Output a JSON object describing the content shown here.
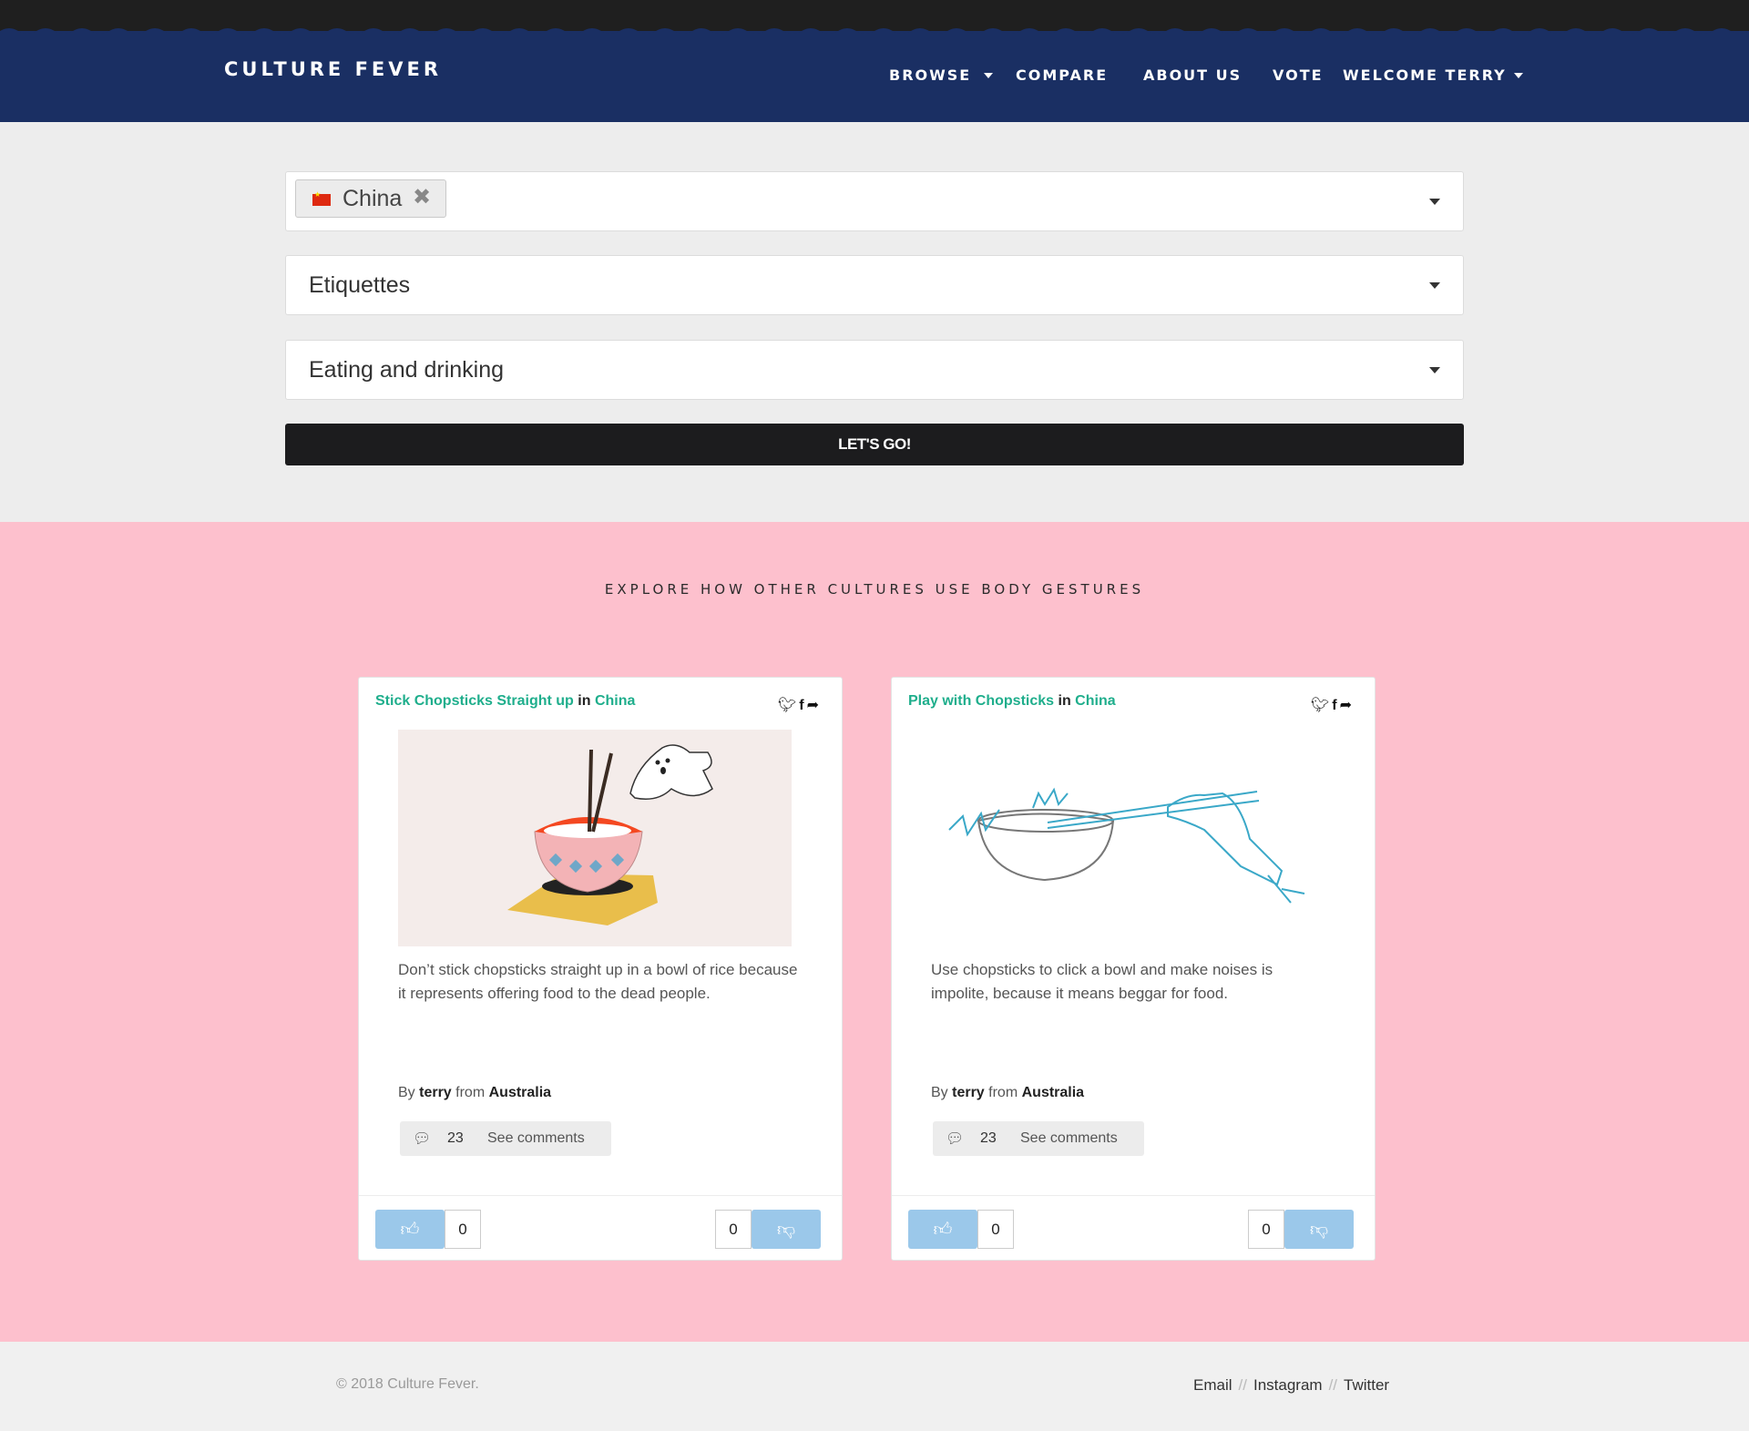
{
  "brand": "CULTURE FEVER",
  "nav": {
    "browse": "BROWSE",
    "compare": "COMPARE",
    "about": "ABOUT US",
    "vote": "VOTE",
    "welcome": "WELCOME TERRY"
  },
  "filters": {
    "country_tag": "China",
    "category": "Etiquettes",
    "subcategory": "Eating and drinking",
    "go_label": "LET'S GO!"
  },
  "section_title": "EXPLORE HOW OTHER CULTURES USE BODY GESTURES",
  "cards": [
    {
      "title": "Stick Chopsticks Straight up",
      "in": "in",
      "country": "China",
      "description": "Don’t stick chopsticks straight up in a bowl of rice because it represents offering food to the dead people.",
      "by": "By",
      "author": "terry",
      "from": "from",
      "origin": "Australia",
      "comment_count": "23",
      "see_comments": "See comments",
      "likes": "0",
      "dislikes": "0"
    },
    {
      "title": "Play with Chopsticks",
      "in": "in",
      "country": "China",
      "description": "Use chopsticks to click a bowl and make noises is impolite, because it means beggar for food.",
      "by": "By",
      "author": "terry",
      "from": "from",
      "origin": "Australia",
      "comment_count": "23",
      "see_comments": "See comments",
      "likes": "0",
      "dislikes": "0"
    }
  ],
  "footer": {
    "copyright": "© 2018 Culture Fever.",
    "links": [
      "Email",
      "Instagram",
      "Twitter"
    ],
    "separator": "//"
  },
  "icons": {
    "share": [
      "twitter-icon",
      "facebook-icon",
      "share-arrow-icon"
    ],
    "comment": "speech-bubble-icon",
    "like": "thumbs-up-icon",
    "dislike": "thumbs-down-icon"
  },
  "colors": {
    "header": "#1a2f63",
    "pink": "#fdc0cd",
    "accent_green": "#1fae8c",
    "vote_button": "#9bc8ea",
    "go_button": "#1c1c1e"
  }
}
